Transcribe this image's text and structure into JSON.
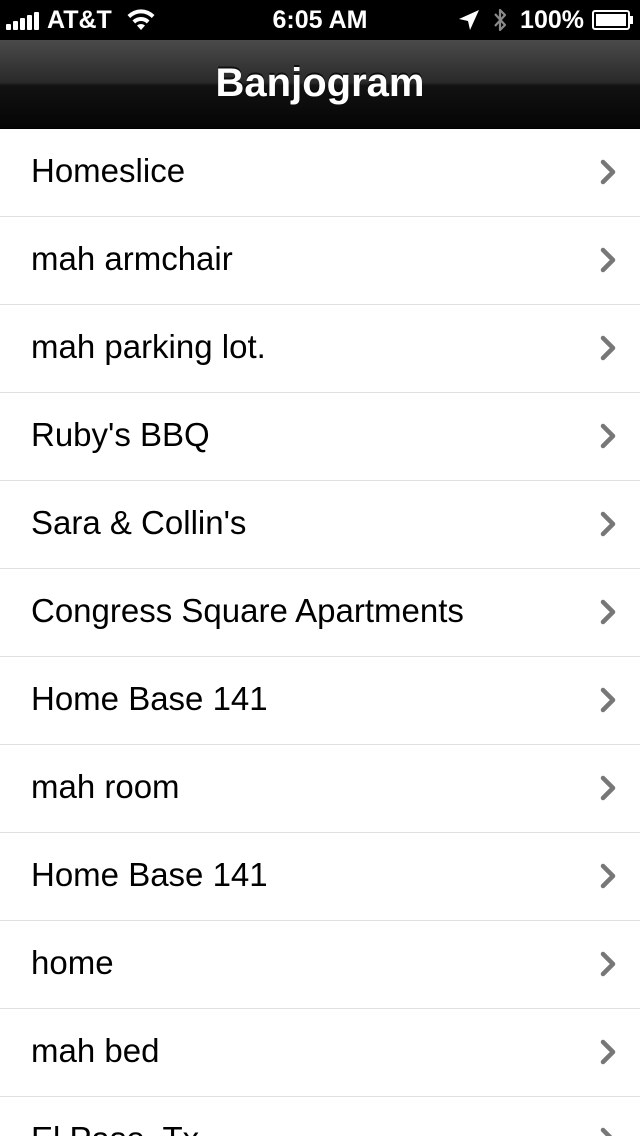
{
  "status_bar": {
    "carrier": "AT&T",
    "time": "6:05 AM",
    "battery_percent": "100%",
    "icons": [
      "signal-bars-icon",
      "wifi-icon",
      "location-arrow-icon",
      "bluetooth-icon",
      "battery-icon"
    ]
  },
  "nav_bar": {
    "title": "Banjogram"
  },
  "list": {
    "items": [
      {
        "label": "Homeslice"
      },
      {
        "label": "mah armchair"
      },
      {
        "label": "mah parking lot."
      },
      {
        "label": "Ruby's BBQ"
      },
      {
        "label": "Sara & Collin's"
      },
      {
        "label": "Congress Square Apartments"
      },
      {
        "label": "Home Base 141"
      },
      {
        "label": "mah room"
      },
      {
        "label": "Home Base 141"
      },
      {
        "label": "home"
      },
      {
        "label": "mah bed"
      },
      {
        "label": "El Paso, Tx"
      }
    ],
    "accessory_icon": "chevron-right-icon"
  },
  "colors": {
    "status_bar_bg": "#000000",
    "nav_bar_top": "#4a4a4a",
    "nav_bar_bottom": "#050505",
    "list_bg": "#ffffff",
    "separator": "#e0e0e0",
    "chevron": "#777777",
    "text": "#000000"
  }
}
